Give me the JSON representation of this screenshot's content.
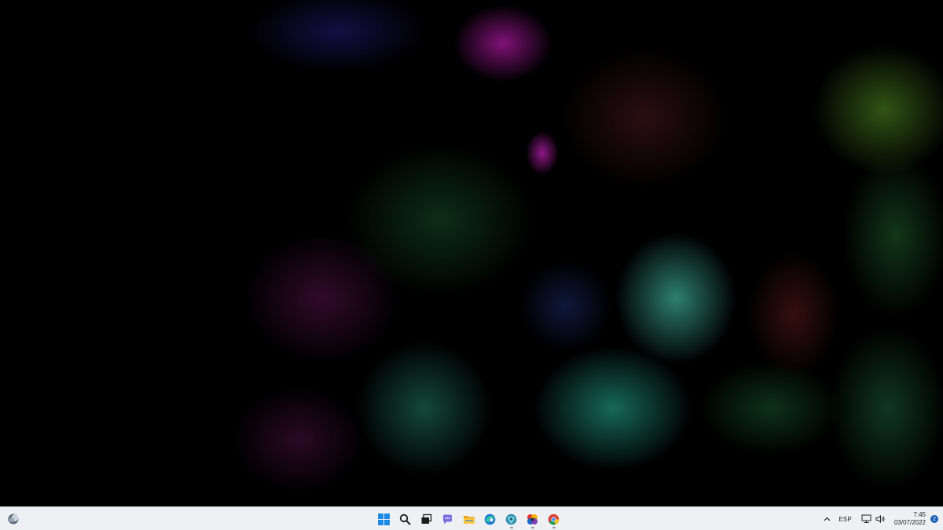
{
  "desktop": {
    "wallpaper": "abstract dark fluid swirls in magenta, green and teal"
  },
  "taskbar": {
    "widgets": {
      "icon": "weather-widget-icon"
    },
    "apps": [
      {
        "name": "start-button",
        "icon": "windows-logo-icon",
        "running": false
      },
      {
        "name": "search-button",
        "icon": "search-icon",
        "running": false
      },
      {
        "name": "task-view-button",
        "icon": "task-view-icon",
        "running": false
      },
      {
        "name": "chat-button",
        "icon": "chat-icon",
        "running": false
      },
      {
        "name": "file-explorer-button",
        "icon": "folder-icon",
        "running": false
      },
      {
        "name": "edge-button",
        "icon": "edge-icon",
        "running": false
      },
      {
        "name": "store-button",
        "icon": "store-icon",
        "running": true
      },
      {
        "name": "photos-button",
        "icon": "photos-icon",
        "running": true
      },
      {
        "name": "chrome-button",
        "icon": "chrome-icon",
        "running": true
      }
    ],
    "tray": {
      "language": "ESP",
      "time": "7:45",
      "date": "03/07/2022",
      "notifications": "2"
    }
  }
}
